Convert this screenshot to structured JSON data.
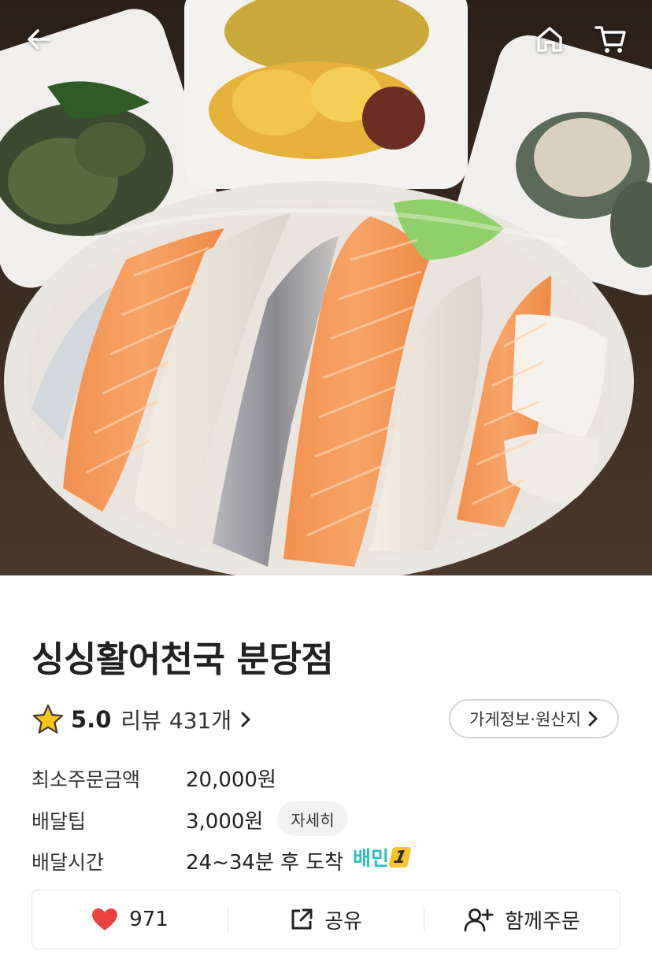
{
  "header": {
    "back_icon": "arrow-left-icon",
    "home_icon": "home-icon",
    "cart_icon": "cart-icon"
  },
  "hero": {
    "description": ""
  },
  "store": {
    "name": "싱싱활어천국 분당점",
    "rating": "5.0",
    "review_label": "리뷰",
    "review_count": "431개",
    "info_button": "가게정보·원산지"
  },
  "details": [
    {
      "label": "최소주문금액",
      "value": "20,000원"
    },
    {
      "label": "배달팁",
      "value": "3,000원",
      "button": "자세히"
    },
    {
      "label": "배달시간",
      "value": "24~34분 후 도착",
      "badge_text": "배민",
      "badge_num": "1"
    }
  ],
  "actions": {
    "like_count": "971",
    "share_label": "공유",
    "group_order_label": "함께주문"
  },
  "colors": {
    "star": "#f5c518",
    "heart": "#e8413f",
    "baemin_mint": "#2ac1bc"
  }
}
